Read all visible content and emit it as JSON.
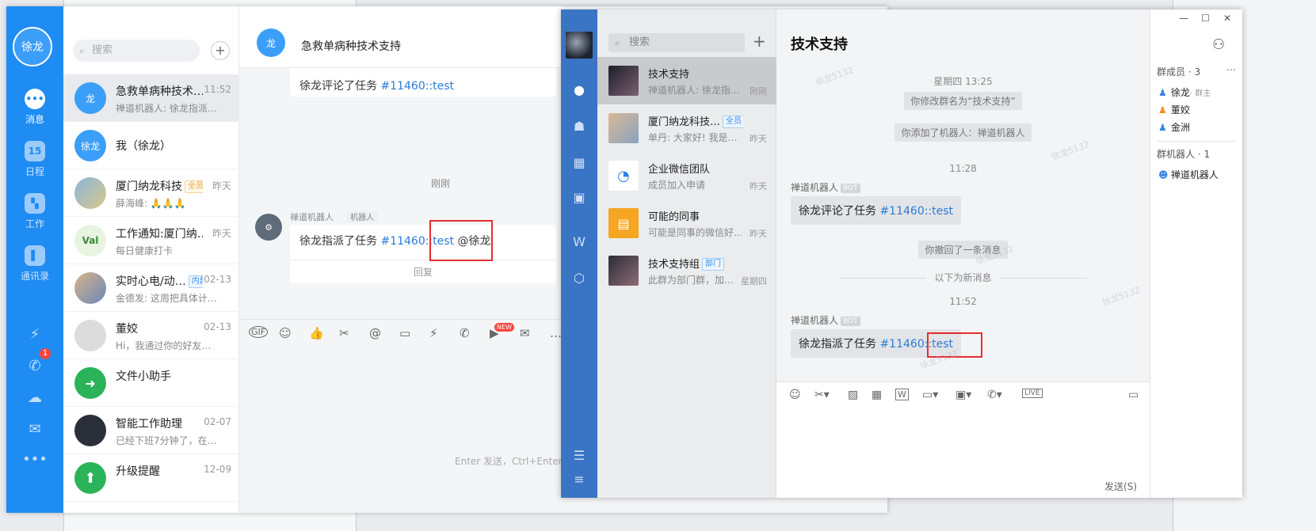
{
  "winA": {
    "user_avatar": "徐龙",
    "nav": [
      {
        "label": "消息",
        "icon": "chat-bubble-icon"
      },
      {
        "label": "日程",
        "icon": "calendar-icon",
        "glyph": "15"
      },
      {
        "label": "工作",
        "icon": "grid-icon"
      },
      {
        "label": "通讯录",
        "icon": "contacts-icon"
      }
    ],
    "notification_count": "1",
    "search_placeholder": "搜索",
    "conversations": [
      {
        "avatar": "龙",
        "name": "急救单病种技术…",
        "time": "11:52",
        "preview": "禅道机器人: 徐龙指派…"
      },
      {
        "avatar": "徐龙",
        "name": "我（徐龙）",
        "time": "",
        "preview": ""
      },
      {
        "avatar": "",
        "name": "厦门纳龙科技",
        "tag": "全员",
        "time": "昨天",
        "preview": "薛海峰: 🙏🙏🙏"
      },
      {
        "avatar": "Val",
        "name": "工作通知:厦门纳…",
        "time": "昨天",
        "preview": "每日健康打卡"
      },
      {
        "avatar": "",
        "name": "实时心电/动…",
        "tag": "内部",
        "time": "02-13",
        "preview": "金德发: 这周把具体计…"
      },
      {
        "avatar": "",
        "name": "董姣",
        "time": "02-13",
        "preview": "Hi，我通过你的好友…"
      },
      {
        "avatar": "",
        "name": "文件小助手",
        "time": "",
        "preview": ""
      },
      {
        "avatar": "",
        "name": "智能工作助理",
        "time": "02-07",
        "preview": "已经下班7分钟了，在…"
      },
      {
        "avatar": "",
        "name": "升级提醒",
        "time": "12-09",
        "preview": ""
      }
    ],
    "chat": {
      "header_avatar": "龙",
      "title": "急救单病种技术支持",
      "msg1_text": "徐龙评论了任务 ",
      "msg1_link": "#11460::test",
      "time_label": "刚刚",
      "sender": "禅道机器人",
      "sender_tag": "机器人",
      "bot_avatar": "bot",
      "msg2_text": "徐龙指派了任务 ",
      "msg2_link": "#11460::test",
      "msg2_mention": " @徐龙",
      "reply_label": "回复",
      "new_badge": "NEW",
      "input_hint": "Enter 发送，Ctrl+Enter 换行"
    }
  },
  "winB": {
    "search_placeholder": "搜索",
    "conversations": [
      {
        "name": "技术支持",
        "preview": "禅道机器人: 徐龙指…",
        "time": "刚刚"
      },
      {
        "name": "厦门纳龙科技…",
        "tag": "全员",
        "preview": "单丹: 大家好! 我是…",
        "time": "昨天"
      },
      {
        "name": "企业微信团队",
        "preview": "成员加入申请",
        "time": "昨天"
      },
      {
        "name": "可能的同事",
        "preview": "可能是同事的微信好…",
        "time": "昨天"
      },
      {
        "name": "技术支持组",
        "tag": "部门",
        "preview": "此群为部门群，加…",
        "time": "星期四"
      }
    ],
    "chat": {
      "title": "技术支持",
      "time1": "星期四 13:25",
      "sys1": "你修改群名为“技术支持”",
      "sys2": "你添加了机器人：禅道机器人",
      "time2": "11:28",
      "sender": "禅道机器人",
      "bot_tag": "BOT",
      "msg1_text": "徐龙评论了任务 ",
      "msg1_link": "#11460::test",
      "sys3": "你撤回了一条消息",
      "divider": "以下为新消息",
      "time3": "11:52",
      "msg2_text": "徐龙指派了任务 ",
      "msg2_link": "#11460::test",
      "send_label": "发送(S)"
    },
    "side": {
      "members_title": "群成员 · 3",
      "members": [
        {
          "name": "徐龙",
          "role": "· 群主"
        },
        {
          "name": "董姣",
          "role": ""
        },
        {
          "name": "金洲",
          "role": ""
        }
      ],
      "bots_title": "群机器人 · 1",
      "bots": [
        {
          "name": "禅道机器人"
        }
      ]
    },
    "watermark": "徐龙5132"
  },
  "colors": {
    "dingtalk_blue": "#1f8cf3",
    "wecom_blue": "#3a74c4",
    "link_blue": "#2a7bd8",
    "highlight_red": "#e62e2e"
  }
}
